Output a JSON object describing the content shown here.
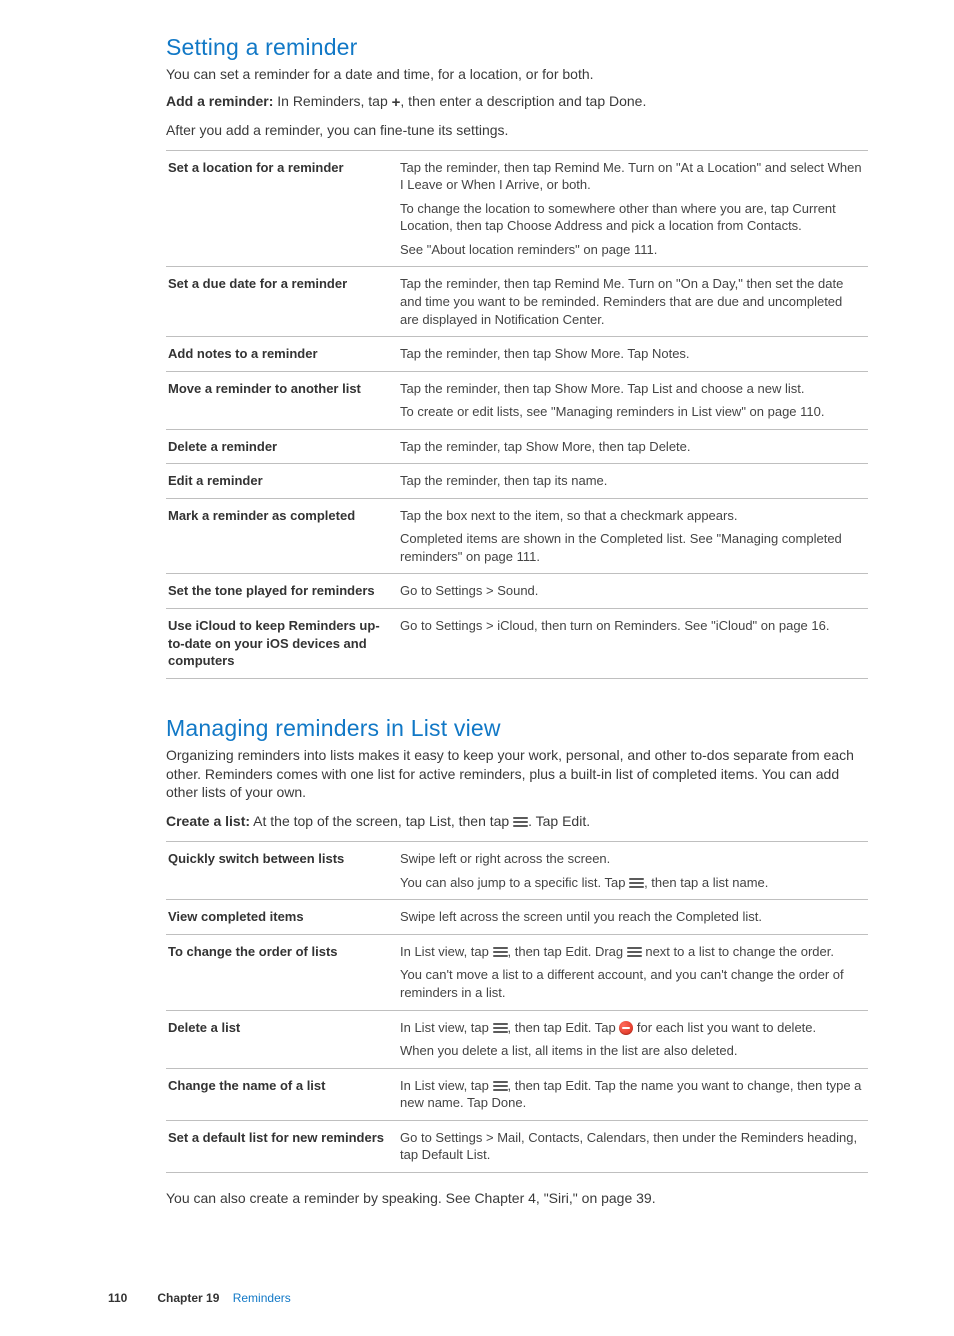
{
  "section1": {
    "title": "Setting a reminder",
    "intro": "You can set a reminder for a date and time, for a location, or for both.",
    "add_label": "Add a reminder:",
    "add_text_before": "  In Reminders, tap ",
    "add_text_after": ", then enter a description and tap Done.",
    "after_add": "After you add a reminder, you can fine-tune its settings.",
    "rows": [
      {
        "label": "Set a location for a reminder",
        "desc": [
          "Tap the reminder, then tap Remind Me. Turn on \"At a Location\" and select When I Leave or When I Arrive, or both.",
          "To change the location to somewhere other than where you are, tap Current Location, then tap Choose Address and pick a location from Contacts.",
          "See \"About location reminders\" on page 111."
        ]
      },
      {
        "label": "Set a due date for a reminder",
        "desc": [
          "Tap the reminder, then tap Remind Me. Turn on \"On a Day,\" then set the date and time you want to be reminded. Reminders that are due and uncompleted are displayed in Notification Center."
        ]
      },
      {
        "label": "Add notes to a reminder",
        "desc": [
          "Tap the reminder, then tap Show More. Tap Notes."
        ]
      },
      {
        "label": "Move a reminder to another list",
        "desc": [
          "Tap the reminder, then tap Show More. Tap List and choose a new list.",
          "To create or edit lists, see \"Managing reminders in List view\" on page 110."
        ]
      },
      {
        "label": "Delete a reminder",
        "desc": [
          "Tap the reminder, tap Show More, then tap Delete."
        ]
      },
      {
        "label": "Edit a reminder",
        "desc": [
          "Tap the reminder, then tap its name."
        ]
      },
      {
        "label": "Mark a reminder as completed",
        "desc": [
          "Tap the box next to the item, so that a checkmark appears.",
          "Completed items are shown in the Completed list. See \"Managing completed reminders\" on page 111."
        ]
      },
      {
        "label": "Set the tone played for reminders",
        "desc": [
          "Go to Settings > Sound."
        ]
      },
      {
        "label": "Use iCloud to keep Reminders up-to-date on your iOS devices and computers",
        "desc": [
          "Go to Settings > iCloud, then turn on Reminders. See \"iCloud\" on page 16."
        ]
      }
    ]
  },
  "section2": {
    "title": "Managing reminders in List view",
    "intro": "Organizing reminders into lists makes it easy to keep your work, personal, and other to-dos separate from each other. Reminders comes with one list for active reminders, plus a built-in list of completed items. You can add other lists of your own.",
    "create_label": "Create a list:",
    "create_before": "  At the top of the screen, tap List, then tap ",
    "create_after": ". Tap Edit.",
    "rows": [
      {
        "label": "Quickly switch between lists",
        "parts": [
          {
            "t": "Swipe left or right across the screen."
          },
          {
            "br": true
          },
          {
            "t": "You can also jump to a specific list. Tap "
          },
          {
            "icon": "list"
          },
          {
            "t": ", then tap a list name."
          }
        ]
      },
      {
        "label": "View completed items",
        "parts": [
          {
            "t": "Swipe left across the screen until you reach the Completed list."
          }
        ]
      },
      {
        "label": "To change the order of lists",
        "parts": [
          {
            "t": "In List view, tap "
          },
          {
            "icon": "list"
          },
          {
            "t": ", then tap Edit. Drag "
          },
          {
            "icon": "list"
          },
          {
            "t": " next to a list to change the order."
          },
          {
            "br": true
          },
          {
            "t": "You can't move a list to a different account, and you can't change the order of reminders in a list."
          }
        ]
      },
      {
        "label": "Delete a list",
        "parts": [
          {
            "t": "In List view, tap "
          },
          {
            "icon": "list"
          },
          {
            "t": ", then tap Edit. Tap "
          },
          {
            "icon": "minus"
          },
          {
            "t": " for each list you want to delete."
          },
          {
            "br": true
          },
          {
            "t": "When you delete a list, all items in the list are also deleted."
          }
        ]
      },
      {
        "label": "Change the name of a list",
        "parts": [
          {
            "t": "In List view, tap "
          },
          {
            "icon": "list"
          },
          {
            "t": ", then tap Edit. Tap the name you want to change, then type a new name. Tap Done."
          }
        ]
      },
      {
        "label": "Set a default list for new reminders",
        "parts": [
          {
            "t": "Go to Settings > Mail, Contacts, Calendars, then under the Reminders heading, tap Default List."
          }
        ]
      }
    ],
    "outro": "You can also create a reminder by speaking. See Chapter 4, \"Siri,\" on page 39."
  },
  "footer": {
    "page": "110",
    "chapter": "Chapter 19",
    "section": "Reminders"
  }
}
